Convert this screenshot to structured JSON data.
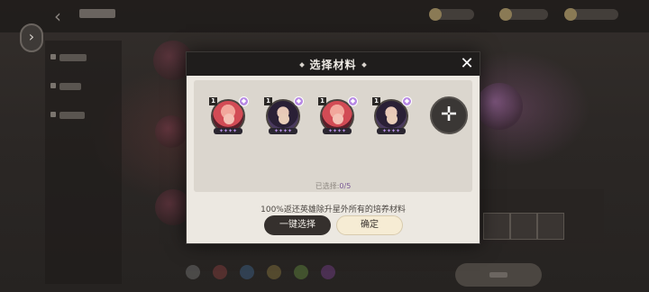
{
  "modal": {
    "title": "选择材料",
    "close_icon": "close-icon",
    "selected_label": "已选择:",
    "selected_count": "0/5",
    "hint": "100%返还英雄除升星外所有的培养材料",
    "auto_select_label": "一键选择",
    "confirm_label": "确定",
    "add_icon": "plus-icon",
    "heroes": [
      {
        "level": "1",
        "stars": "✦✦✦✦",
        "element_icon": "diamond-icon",
        "portrait": "red-hair-hero"
      },
      {
        "level": "1",
        "stars": "✦✦✦✦",
        "element_icon": "diamond-icon",
        "portrait": "dark-hair-hero"
      },
      {
        "level": "1",
        "stars": "✦✦✦✦",
        "element_icon": "diamond-icon",
        "portrait": "red-hair-hero"
      },
      {
        "level": "1",
        "stars": "✦✦✦✦",
        "element_icon": "diamond-icon",
        "portrait": "dark-hair-hero"
      }
    ]
  },
  "colors": {
    "accent_purple": "#b788e4",
    "confirm_bg": "#f6ecd4",
    "auto_bg": "#35302d"
  }
}
